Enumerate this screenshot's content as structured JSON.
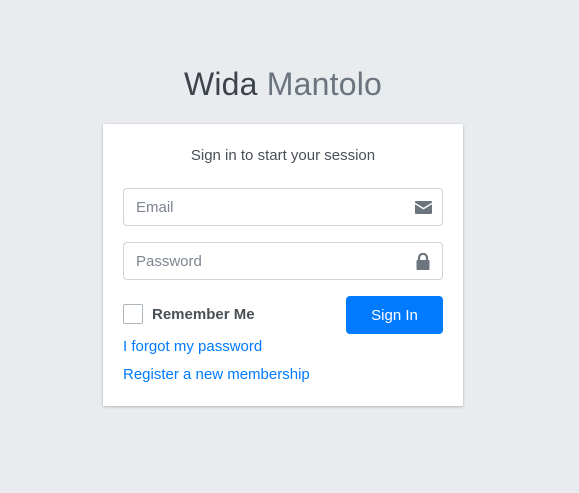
{
  "logo": {
    "bold": "Wida",
    "light": "Mantolo"
  },
  "login": {
    "message": "Sign in to start your session",
    "email_placeholder": "Email",
    "password_placeholder": "Password",
    "email_icon": "envelope-icon",
    "password_icon": "lock-icon",
    "remember_label": "Remember Me",
    "remember_checked": false,
    "signin_label": "Sign In",
    "forgot_label": "I forgot my password",
    "register_label": "Register a new membership"
  },
  "colors": {
    "background": "#e9ecef",
    "primary": "#007bff",
    "text": "#495057",
    "icon": "#6c757d"
  }
}
